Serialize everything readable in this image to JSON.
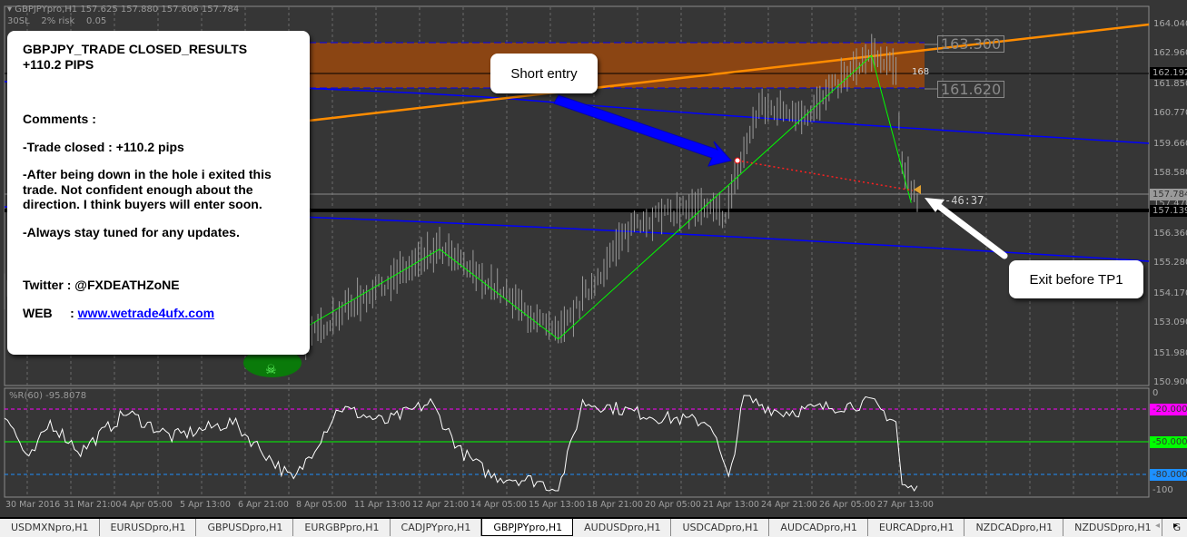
{
  "header": {
    "symbol": "GBPJPYpro,H1",
    "ohlc": "157.625 157.880 157.606 157.784",
    "sl": "30SL",
    "risk": "2% risk",
    "lots": "0.05"
  },
  "note": {
    "title1": "GBPJPY_TRADE CLOSED_RESULTS",
    "title2": "+110.2 PIPS",
    "comments": "Comments :",
    "line1": "-Trade closed : +110.2 pips",
    "line2": "-After being down in the hole i exited this trade. Not confident enough about the direction. I think buyers will enter soon.",
    "line3": "-Always stay tuned for any updates.",
    "twitter": "Twitter : @FXDEATHZoNE",
    "web_label": "WEB     : ",
    "web_link": "www.wetrade4ufx.com"
  },
  "callouts": {
    "entry": "Short entry",
    "exit": "Exit before TP1"
  },
  "levels": {
    "upper": "163.300",
    "lower": "161.620",
    "fib": "168",
    "countdown": "-46:37"
  },
  "price_axis": {
    "labels": [
      "164.040",
      "162.960",
      "161.850",
      "160.770",
      "159.660",
      "158.580",
      "157.470",
      "156.360",
      "155.280",
      "154.170",
      "153.090",
      "151.980",
      "150.900"
    ],
    "values": [
      164.04,
      162.96,
      161.85,
      160.77,
      159.66,
      158.58,
      157.47,
      156.36,
      155.28,
      154.17,
      153.09,
      151.98,
      150.9
    ],
    "bid": "157.784",
    "line_black": "162.192",
    "line_thick": "157.139"
  },
  "indicator": {
    "title": "%R(60) -95.8078",
    "levels": [
      "0",
      "-20.0000",
      "-50.0000",
      "-80.0000",
      "-100"
    ],
    "colors": {
      "-20": "#ff00ff",
      "-50": "#00ff00",
      "-80": "#1e90ff"
    }
  },
  "time_axis": [
    "30 Mar 2016",
    "31 Mar 21:00",
    "4 Apr 05:00",
    "5 Apr 13:00",
    "6 Apr 21:00",
    "8 Apr 05:00",
    "11 Apr 13:00",
    "12 Apr 21:00",
    "14 Apr 05:00",
    "15 Apr 13:00",
    "18 Apr 21:00",
    "20 Apr 05:00",
    "21 Apr 13:00",
    "24 Apr 21:00",
    "26 Apr 05:00",
    "27 Apr 13:00"
  ],
  "tabs": [
    "USDMXNpro,H1",
    "EURUSDpro,H1",
    "GBPUSDpro,H1",
    "EURGBPpro,H1",
    "CADJPYpro,H1",
    "GBPJPYpro,H1",
    "AUDUSDpro,H1",
    "USDCADpro,H1",
    "AUDCADpro,H1",
    "EURCADpro,H1",
    "NZDCADpro,H1",
    "NZDUSDpro,H1",
    "G"
  ],
  "active_tab": "GBPJPYpro,H1",
  "chart_data": {
    "type": "bar",
    "price_anchors": [
      [
        0,
        154.5
      ],
      [
        30,
        153.5
      ],
      [
        60,
        154.0
      ],
      [
        100,
        152.5
      ],
      [
        110,
        153.5
      ],
      [
        143,
        155.8
      ],
      [
        160,
        154.5
      ],
      [
        182,
        152.6
      ],
      [
        195,
        154.8
      ],
      [
        207,
        156.8
      ],
      [
        225,
        157.3
      ],
      [
        237,
        157.1
      ],
      [
        242,
        159.0
      ],
      [
        248,
        161.0
      ],
      [
        265,
        160.8
      ],
      [
        275,
        162.0
      ],
      [
        285,
        162.9
      ],
      [
        293,
        162.3
      ],
      [
        295,
        159.0
      ],
      [
        300,
        157.6
      ]
    ],
    "zigzag": [
      [
        100,
        153.0
      ],
      [
        143,
        155.8
      ],
      [
        182,
        152.5
      ],
      [
        285,
        162.9
      ],
      [
        298,
        157.5
      ]
    ],
    "ylim": [
      150.9,
      164.04
    ],
    "wpr_anchors": [
      [
        0,
        -20
      ],
      [
        8,
        -70
      ],
      [
        15,
        -30
      ],
      [
        25,
        -60
      ],
      [
        40,
        -20
      ],
      [
        55,
        -45
      ],
      [
        75,
        -30
      ],
      [
        95,
        -90
      ],
      [
        110,
        -15
      ],
      [
        125,
        -30
      ],
      [
        140,
        -10
      ],
      [
        150,
        -60
      ],
      [
        160,
        -85
      ],
      [
        175,
        -90
      ],
      [
        182,
        -100
      ],
      [
        190,
        -10
      ],
      [
        200,
        -15
      ],
      [
        215,
        -25
      ],
      [
        232,
        -30
      ],
      [
        238,
        -90
      ],
      [
        243,
        -5
      ],
      [
        255,
        -20
      ],
      [
        270,
        -15
      ],
      [
        285,
        -10
      ],
      [
        293,
        -30
      ],
      [
        295,
        -95
      ],
      [
        300,
        -100
      ]
    ]
  },
  "colors": {
    "bg": "#363636",
    "zone": "#8b4513",
    "trend": "#ff8c00",
    "channel": "#0000ff",
    "zigzag": "#00ff00"
  }
}
